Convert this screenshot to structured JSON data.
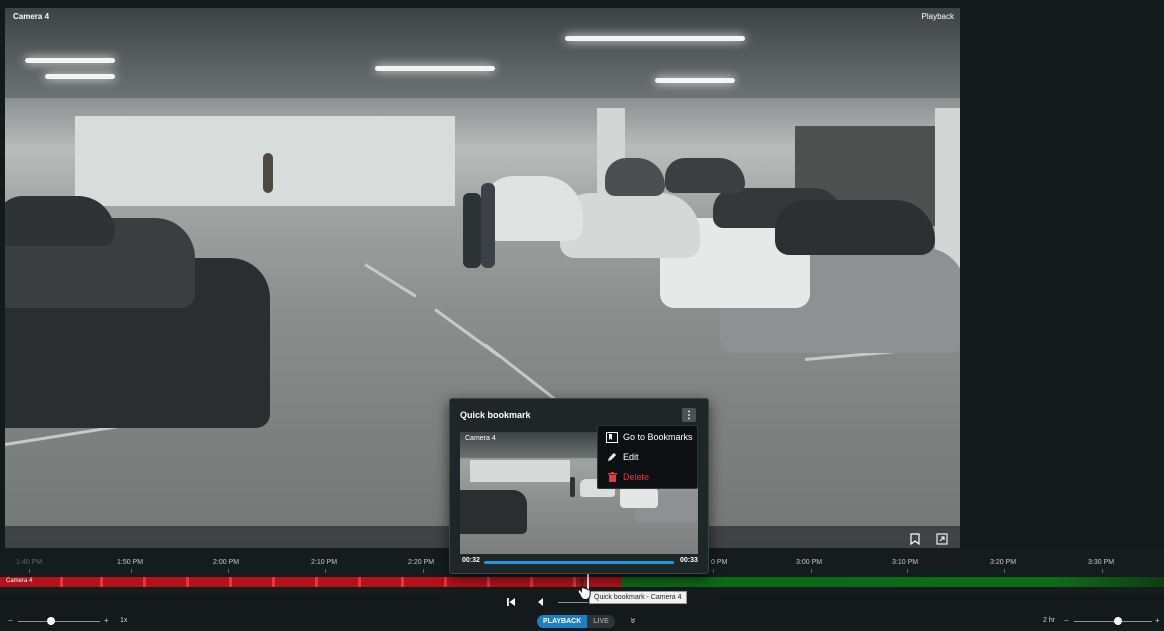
{
  "camera": {
    "title": "Camera 4",
    "mode": "Playback"
  },
  "timeline": {
    "ticks": [
      "1:40 PM",
      "1:50 PM",
      "2:00 PM",
      "2:10 PM",
      "2:20 PM",
      "3:00 PM",
      "3:10 PM",
      "3:20 PM",
      "3:30 PM"
    ],
    "partial_tick": "0 PM",
    "track_label": "Camera 4",
    "recording_color": "#b2121a",
    "live_color": "#0f6b18"
  },
  "quick_bookmark": {
    "title": "Quick bookmark",
    "thumb_title": "Camera 4",
    "start_time": "00:32",
    "end_time": "00:33",
    "menu": {
      "go_to_bookmarks": "Go to Bookmarks",
      "edit": "Edit",
      "delete": "Delete"
    }
  },
  "tooltip": "Quick bookmark - Camera 4",
  "bottom_bar": {
    "speed_minus": "−",
    "speed_plus": "+",
    "speed_value": "1x",
    "mode_playback": "PLAYBACK",
    "mode_live": "LIVE",
    "expand_icon": "»",
    "zoom_value": "2 hr",
    "zoom_minus": "−",
    "zoom_plus": "+"
  },
  "colors": {
    "accent": "#1d7fc2",
    "danger": "#e23b3b"
  },
  "icons": [
    "bookmark-icon",
    "fullscreen-icon",
    "skip-start-icon",
    "step-back-icon",
    "kebab-menu-icon",
    "bookmarks-icon",
    "pencil-icon",
    "trash-icon",
    "pointer-cursor-icon"
  ]
}
